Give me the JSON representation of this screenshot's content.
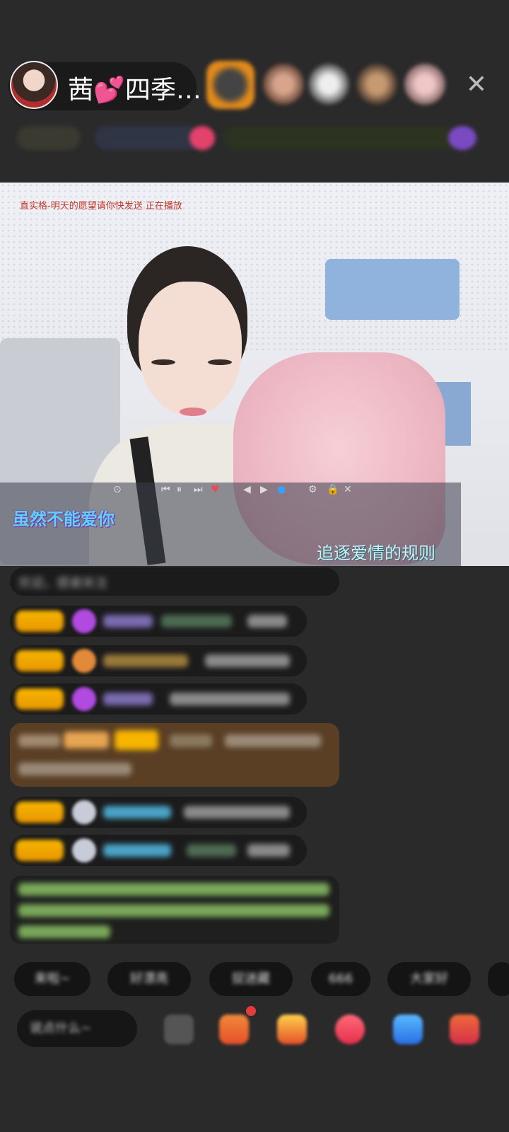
{
  "header": {
    "host_name": "茜💕四季…",
    "close_symbol": "✕"
  },
  "video": {
    "caption": "直实格-明天的愿望请你快发送 正在播放",
    "player_controls": [
      "⊙",
      "⏮",
      "⏸",
      "⏭",
      "♥",
      "◀",
      "▶",
      "●",
      "⚙",
      "🔒",
      "✕"
    ],
    "lyric_left": "虽然不能爱你",
    "lyric_right": "追逐爱情的规则"
  },
  "chat": {
    "first_line": "欢迎，感谢关注"
  },
  "quick_replies": [
    "来啦~",
    "好漂亮",
    "捉迷藏",
    "666",
    "大家好"
  ],
  "bottom": {
    "say_placeholder": "说点什么~"
  },
  "colors": {
    "background": "#2a2a2b",
    "badge": "#f7b500",
    "lyric_cyan": "#5ed2ff",
    "lyric_outline": "#7a2a9c",
    "highlight_bg": "#5a3f25"
  }
}
